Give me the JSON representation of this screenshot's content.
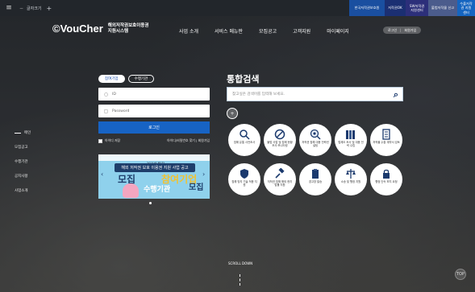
{
  "topbar": {
    "tab_label": "글자크기",
    "links": [
      {
        "label": "한국저작권보호원"
      },
      {
        "label": "저작권OK"
      },
      {
        "label": "SW저작권지원센터"
      },
      {
        "label": "불법저작물 신고"
      },
      {
        "label": "수출저작권 지원센터"
      }
    ]
  },
  "header": {
    "logo": "©VouCher",
    "logo_sub_line1": "해외저작권보호이용권",
    "logo_sub_line2": "지원시스템",
    "nav": [
      "사업 소개",
      "서비스 메뉴판",
      "모집공고",
      "고객지원",
      "마이페이지"
    ],
    "login_btn": "로그인",
    "join_btn": "회원가입"
  },
  "sidebar": {
    "items": [
      {
        "label": "메인",
        "active": true
      },
      {
        "label": "모집공고"
      },
      {
        "label": "수행기관"
      },
      {
        "label": "공지사항"
      },
      {
        "label": "사업소개"
      }
    ]
  },
  "login": {
    "tabs": [
      "참여기업",
      "수행기관"
    ],
    "id_placeholder": "ID",
    "pw_placeholder": "Password",
    "submit": "로그인",
    "save_id": "아이디 저장",
    "find_links": "아이디/비밀번호 찾기 | 회원가입"
  },
  "banner": {
    "topline": "2021년 제1차",
    "headline": "해외 저작권 보호 이용권 지원 사업 공고",
    "word1": "모집",
    "word2": "참여기업",
    "word3": "수행기관",
    "word4": "모집"
  },
  "search": {
    "title": "통합검색",
    "placeholder": "찾고싶은 검색어를 입력해 보세요.",
    "add_label": "+"
  },
  "services": [
    {
      "icon": "magnifier-docs-icon",
      "label": "침해 유통 사전조사"
    },
    {
      "icon": "no-sign-icon",
      "label": "불법 사업 및 침해 현황 조사·모니터링"
    },
    {
      "icon": "search-globe-icon",
      "label": "저작권 침해 대응 전략컨설팅"
    },
    {
      "icon": "books-icon",
      "label": "법제도 조사 및 대응 전략 수립"
    },
    {
      "icon": "document-icon",
      "label": "저작물 수출 계약서 검토"
    },
    {
      "icon": "shield-icon",
      "label": "침해 방지 기술 적용 지원"
    },
    {
      "icon": "gavel-icon",
      "label": "저작권 침해 해외 현지 법률 지원"
    },
    {
      "icon": "clipboard-icon",
      "label": "경고장 발송"
    },
    {
      "icon": "scales-icon",
      "label": "소송 및 행정 지원"
    },
    {
      "icon": "lock-doc-icon",
      "label": "행정 단속 조치 요청"
    }
  ],
  "scroll": {
    "label": "SCROLL DOWN"
  },
  "totop": {
    "label": "TOP"
  }
}
